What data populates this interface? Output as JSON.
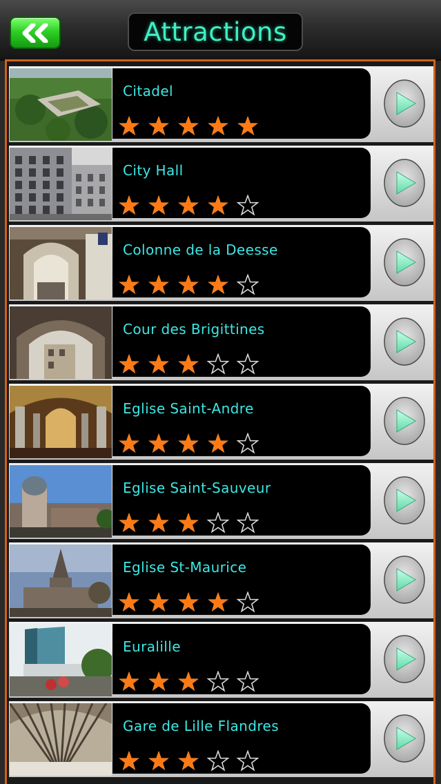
{
  "header": {
    "title": "Attractions",
    "back_icon": "double-chevron-left-icon"
  },
  "colors": {
    "accent": "#3ef0c4",
    "star_filled": "#ff7a15",
    "frame": "#d2621a",
    "name_text": "#3de8e4"
  },
  "attractions": [
    {
      "name": "Citadel",
      "rating": 5
    },
    {
      "name": "City Hall",
      "rating": 4
    },
    {
      "name": "Colonne de la Deesse",
      "rating": 4
    },
    {
      "name": "Cour des Brigittines",
      "rating": 3
    },
    {
      "name": "Eglise Saint-Andre",
      "rating": 4
    },
    {
      "name": "Eglise Saint-Sauveur",
      "rating": 3
    },
    {
      "name": "Eglise St-Maurice",
      "rating": 4
    },
    {
      "name": "Euralille",
      "rating": 3
    },
    {
      "name": "Gare de Lille Flandres",
      "rating": 3
    }
  ]
}
